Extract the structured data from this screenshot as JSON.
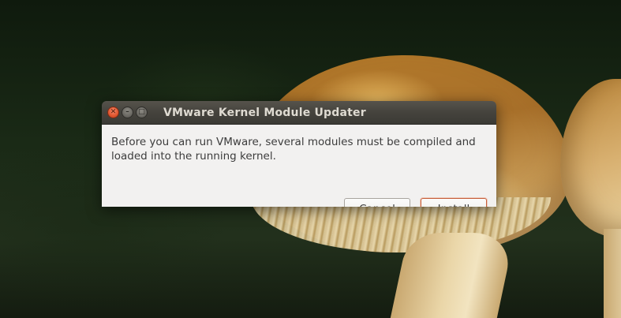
{
  "window": {
    "title": "VMware Kernel Module Updater",
    "controls": {
      "close_icon": "close-icon",
      "minimize_icon": "minimize-icon",
      "maximize_icon": "maximize-icon"
    }
  },
  "dialog": {
    "message_line1": "Before you can run VMware, several modules must be compiled and",
    "message_line2": "loaded into the running kernel.",
    "cancel_label": "Cancel",
    "install_label": "Install"
  },
  "colors": {
    "titlebar": "#3b3a35",
    "close_button": "#e0552e",
    "dialog_background": "#f2f1f0",
    "default_button_border": "#c65e3a"
  }
}
